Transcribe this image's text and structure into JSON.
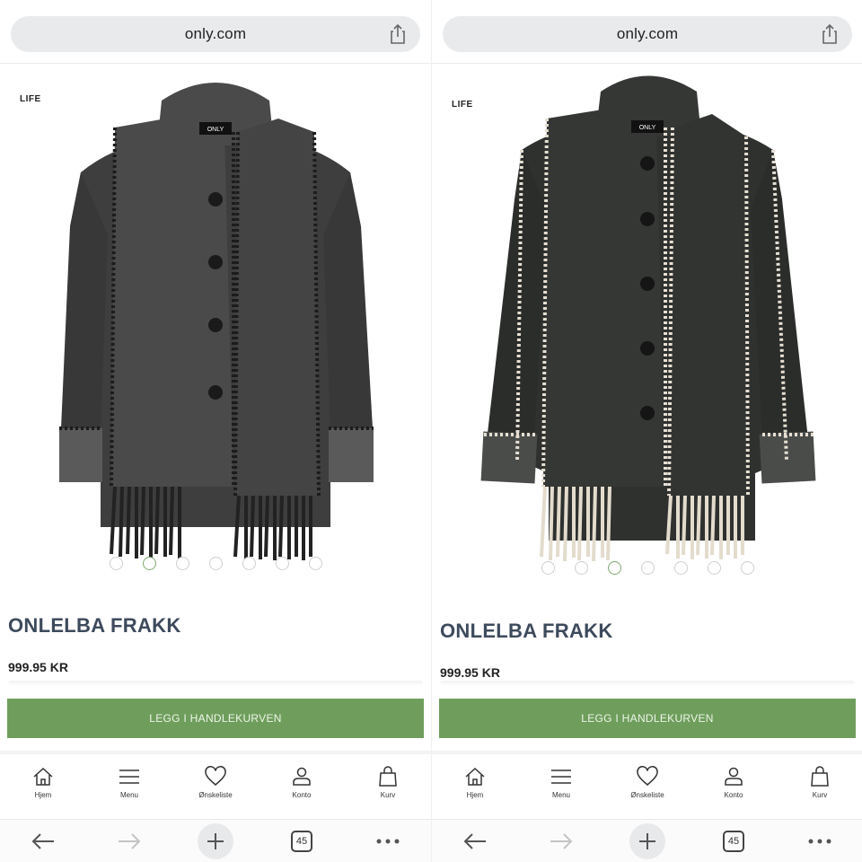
{
  "screens": [
    {
      "url": "only.com",
      "brand_tag": "LIFE",
      "logo_label": "ONLY",
      "variant_colors": {
        "coat": "#3e3e3e",
        "scarf": "#4a4a4a",
        "cuff": "#5a5a5a",
        "stitch": "#1c1c1c",
        "fringe": "#222222"
      },
      "carousel_active_index": 1,
      "carousel_count": 7,
      "product_title": "ONLELBA FRAKK",
      "price": "999.95 KR",
      "cart_button_label": "LEGG I HANDLEKURVEN",
      "nav": [
        {
          "label": "Hjem",
          "icon": "home-icon"
        },
        {
          "label": "Menu",
          "icon": "menu-icon"
        },
        {
          "label": "Ønskeliste",
          "icon": "heart-icon"
        },
        {
          "label": "Konto",
          "icon": "account-icon"
        },
        {
          "label": "Kurv",
          "icon": "bag-icon"
        }
      ],
      "tab_count": "45"
    },
    {
      "url": "only.com",
      "brand_tag": "LIFE",
      "logo_label": "ONLY",
      "variant_colors": {
        "coat": "#2f312f",
        "scarf": "#353735",
        "cuff": "#4a4c4a",
        "stitch": "#e6dfd2",
        "fringe": "#e3dccd"
      },
      "carousel_active_index": 2,
      "carousel_count": 7,
      "product_title": "ONLELBA FRAKK",
      "price": "999.95 KR",
      "cart_button_label": "LEGG I HANDLEKURVEN",
      "nav": [
        {
          "label": "Hjem",
          "icon": "home-icon"
        },
        {
          "label": "Menu",
          "icon": "menu-icon"
        },
        {
          "label": "Ønskeliste",
          "icon": "heart-icon"
        },
        {
          "label": "Konto",
          "icon": "account-icon"
        },
        {
          "label": "Kurv",
          "icon": "bag-icon"
        }
      ],
      "tab_count": "45"
    }
  ],
  "colors": {
    "accent_button": "#6f9e5c",
    "title_text": "#3d4a5c",
    "active_dot": "#7fa870"
  }
}
